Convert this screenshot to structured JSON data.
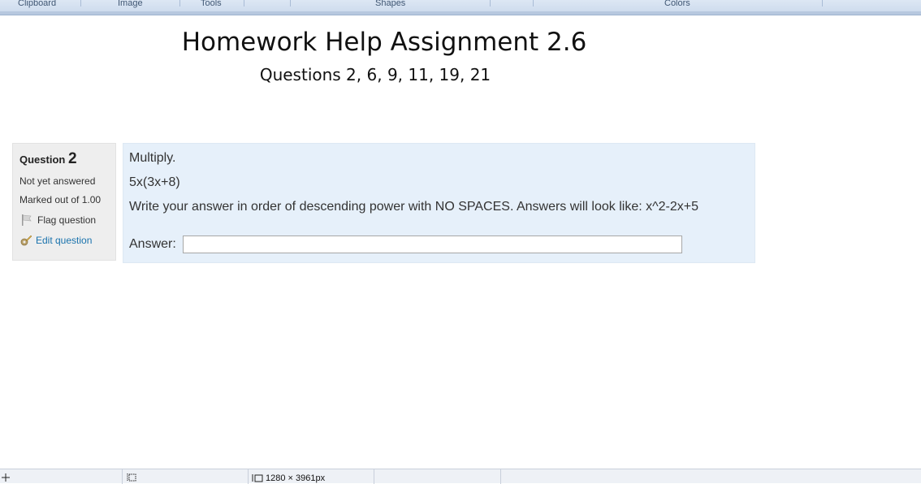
{
  "ribbon": {
    "groups": [
      "Clipboard",
      "Image",
      "Tools",
      "Shapes",
      "Colors"
    ]
  },
  "document": {
    "title": "Homework Help Assignment 2.6",
    "subtitle": "Questions 2, 6, 9, 11, 19, 21"
  },
  "question_info": {
    "label": "Question",
    "number": "2",
    "status": "Not yet answered",
    "marked": "Marked out of 1.00",
    "flag_label": "Flag question",
    "edit_label": "Edit question"
  },
  "question": {
    "instruction": "Multiply.",
    "expression": "5x(3x+8)",
    "note": "Write your answer in order of descending power with NO SPACES. Answers will look like: x^2-2x+5",
    "answer_label": "Answer:",
    "answer_value": ""
  },
  "statusbar": {
    "image_size": "1280 × 3961px"
  },
  "colors": {
    "info_bg": "#eeeeee",
    "content_bg": "#e6f0fa",
    "link": "#1a73ad"
  }
}
